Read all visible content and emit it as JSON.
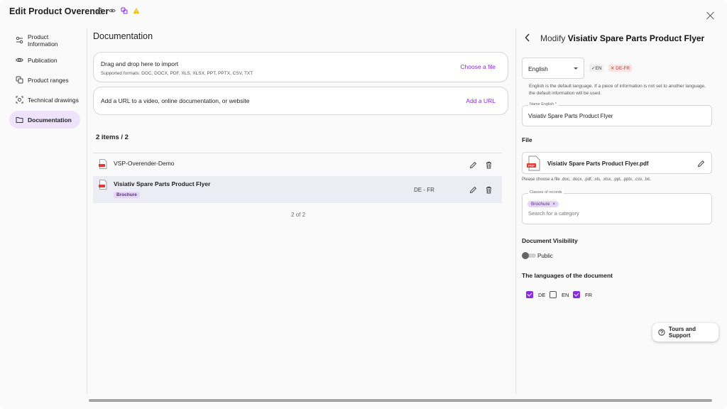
{
  "window": {
    "title": "Edit Product Overender"
  },
  "title_icons": [
    "lock-icon",
    "eye-icon",
    "link-icon",
    "warning-icon"
  ],
  "colors": {
    "accent": "#8a2be2",
    "active_nav_bg": "#efe3fb",
    "selected_row_bg": "#ececf5",
    "warning": "#f5b700",
    "danger": "#c0392b"
  },
  "sidebar": {
    "items": [
      {
        "label": "Product Information",
        "icon": "sliders-icon",
        "active": false
      },
      {
        "label": "Publication",
        "icon": "eye-icon",
        "active": false
      },
      {
        "label": "Product ranges",
        "icon": "copy-icon",
        "active": false
      },
      {
        "label": "Technical drawings",
        "icon": "drawing-icon",
        "active": false
      },
      {
        "label": "Documentation",
        "icon": "folder-icon",
        "active": true
      }
    ]
  },
  "main": {
    "heading": "Documentation",
    "import": {
      "title": "Drag and drop here to import",
      "formats": "Supported formats: DOC, DOCX, PDF, XLS, XLSX, PPT, PPTX, CSV, TXT",
      "choose_label": "Choose a file"
    },
    "url": {
      "title": "Add a URL to a video, online documentation, or website",
      "add_label": "Add a URL"
    },
    "count": "2 items / 2",
    "rows": [
      {
        "name": "VSP-Overender-Demo",
        "tag": "",
        "languages": ""
      },
      {
        "name": "Visiativ Spare Parts Product Flyer",
        "tag": "Brochure",
        "languages": "DE - FR"
      }
    ],
    "pagination": "2 of 2"
  },
  "panel": {
    "title_prefix": "Modify",
    "title_name": "Visiativ Spare Parts Product Flyer",
    "language_select": "English",
    "lang_ok": "EN",
    "lang_missing": "DE-FR",
    "lang_ok_mark": "✓",
    "lang_missing_mark": "✕",
    "info": "English is the default language. If a piece of information is not set to another language, the default information will be used.",
    "name_label": "Name English *",
    "name_value": "Visiativ Spare Parts Product Flyer",
    "file_heading": "File",
    "file_name": "Visiativ Spare Parts Product Flyer.pdf",
    "file_hint": "Please choose a file .doc, .docx, .pdf, .xls, .xlsx, .ppt, .pptx, .csv, .txt.",
    "classes_label": "Classes of records",
    "class_chip": "Brochure",
    "class_remove": "×",
    "search_placeholder": "Search for a category",
    "visibility_heading": "Document Visibility",
    "visibility_label": "Public",
    "visibility_on": false,
    "languages_heading": "The languages of the document",
    "languages": [
      {
        "code": "DE",
        "checked": true
      },
      {
        "code": "EN",
        "checked": false
      },
      {
        "code": "FR",
        "checked": true
      }
    ]
  },
  "help_button": {
    "label": "Tours and Support",
    "icon": "help-circle-icon"
  }
}
